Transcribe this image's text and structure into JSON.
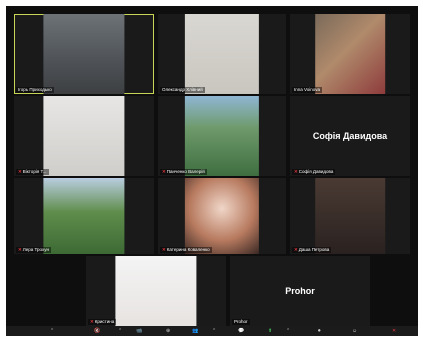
{
  "meeting": {
    "participants": [
      {
        "name": "Ігорь Приходько",
        "muted": false,
        "active_speaker": true,
        "video": "office"
      },
      {
        "name": "Олександр Хлівний",
        "muted": false,
        "active_speaker": false,
        "video": "light"
      },
      {
        "name": "Inna Voinova",
        "muted": false,
        "active_speaker": false,
        "video": "room"
      },
      {
        "name": "Вікторія Т...",
        "muted": true,
        "active_speaker": false,
        "video": "mirror"
      },
      {
        "name": "Панченко Валерій",
        "muted": true,
        "active_speaker": false,
        "video": "park"
      },
      {
        "name": "Софія Давидова",
        "muted": true,
        "active_speaker": false,
        "video": "off"
      },
      {
        "name": "Лера Трохун",
        "muted": true,
        "active_speaker": false,
        "video": "forest"
      },
      {
        "name": "Катерина Коваленко",
        "muted": true,
        "active_speaker": false,
        "video": "warm"
      },
      {
        "name": "Даша Петрова",
        "muted": true,
        "active_speaker": false,
        "video": "dim"
      },
      {
        "name": "Кристина",
        "muted": true,
        "active_speaker": false,
        "video": "studio"
      },
      {
        "name": "Prohor",
        "muted": false,
        "active_speaker": false,
        "video": "off"
      }
    ]
  },
  "toolbar": {
    "items": [
      "⌃",
      "🔇",
      "⌃",
      "📹",
      "⊕",
      "👥",
      "⌃",
      "💬",
      "⬆",
      "⌃",
      "⏺",
      "☺",
      "✕"
    ]
  },
  "colors": {
    "background": "#0e0e0e",
    "tile": "#1a1a1a",
    "active_border": "#c8d454",
    "mute_icon": "#e0363d"
  }
}
